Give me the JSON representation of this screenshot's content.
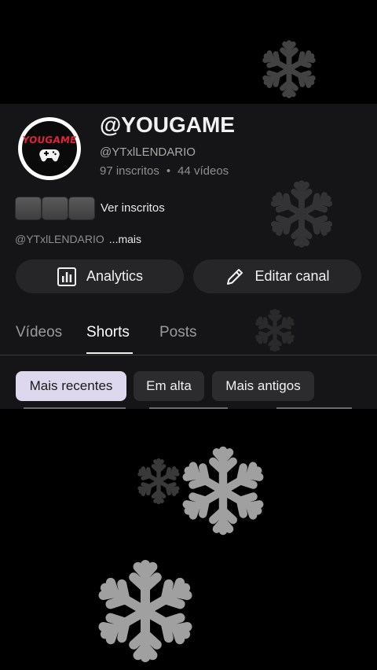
{
  "channel": {
    "name": "@YOUGAME",
    "handle": "@YTxlLENDARIO",
    "subscribers": "97 inscritos",
    "separator": "•",
    "videos_count": "44 vídeos",
    "avatar_logo_text": "YOUGAME"
  },
  "subscribers_link": "Ver inscritos",
  "description": {
    "text": "@YTxlLENDARIO",
    "more": "...mais"
  },
  "actions": {
    "analytics_label": "Analytics",
    "edit_label": "Editar canal"
  },
  "tabs": [
    {
      "label": "Vídeos",
      "active": false
    },
    {
      "label": "Shorts",
      "active": true
    },
    {
      "label": "Posts",
      "active": false
    }
  ],
  "filters": [
    {
      "label": "Mais recentes",
      "selected": true
    },
    {
      "label": "Em alta",
      "selected": false
    },
    {
      "label": "Mais antigos",
      "selected": false
    }
  ],
  "colors": {
    "accent_chip": "#ddd8ee",
    "logo_red": "#e0223a",
    "background": "#000000"
  }
}
